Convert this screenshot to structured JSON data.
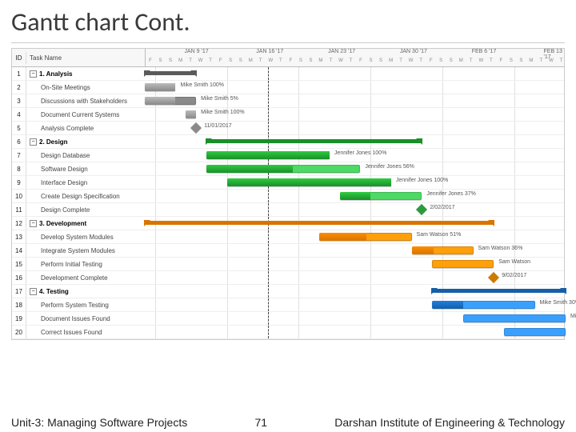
{
  "title": "Gantt chart Cont.",
  "hdr": {
    "id": "ID",
    "task": "Task Name"
  },
  "weeks": [
    "JAN 9 '17",
    "JAN 16 '17",
    "JAN 23 '17",
    "JAN 30 '17",
    "FEB 6 '17",
    "FEB 13 '17"
  ],
  "days": [
    "F",
    "S",
    "S",
    "M",
    "T",
    "W",
    "T",
    "F",
    "S",
    "S",
    "M",
    "T",
    "W",
    "T",
    "F",
    "S",
    "S",
    "M",
    "T",
    "W",
    "T",
    "F",
    "S",
    "S",
    "M",
    "T",
    "W",
    "T",
    "F",
    "S",
    "S",
    "M",
    "T",
    "W",
    "T",
    "F",
    "S",
    "S",
    "M",
    "T",
    "W",
    "T"
  ],
  "chart_data": {
    "type": "gantt",
    "time_axis": {
      "start": "2017-01-06",
      "end": "2017-02-16",
      "today": "2017-01-18"
    },
    "rows": [
      {
        "id": 1,
        "name": "1. Analysis",
        "type": "summary",
        "phase": 1,
        "start": "2017-01-06",
        "end": "2017-01-11"
      },
      {
        "id": 2,
        "name": "On-Site Meetings",
        "type": "task",
        "phase": 1,
        "start": "2017-01-06",
        "end": "2017-01-09",
        "progress": 1.0,
        "assignee": "Mike Smith",
        "pct_label": "100%"
      },
      {
        "id": 3,
        "name": "Discussions with Stakeholders",
        "type": "task",
        "phase": 1,
        "start": "2017-01-06",
        "end": "2017-01-11",
        "progress": 0.59,
        "assignee": "Mike Smith",
        "pct_label": "5%"
      },
      {
        "id": 4,
        "name": "Document Current Systems",
        "type": "task",
        "phase": 1,
        "start": "2017-01-10",
        "end": "2017-01-11",
        "progress": 1.0,
        "assignee": "Mike Smith",
        "pct_label": "100%"
      },
      {
        "id": 5,
        "name": "Analysis Complete",
        "type": "milestone",
        "phase": 1,
        "date": "2017-01-11",
        "label": "11/01/2017"
      },
      {
        "id": 6,
        "name": "2. Design",
        "type": "summary",
        "phase": 2,
        "start": "2017-01-12",
        "end": "2017-02-02"
      },
      {
        "id": 7,
        "name": "Design Database",
        "type": "task",
        "phase": 2,
        "start": "2017-01-12",
        "end": "2017-01-24",
        "progress": 1.0,
        "assignee": "Jennifer Jones",
        "pct_label": "100%"
      },
      {
        "id": 8,
        "name": "Software Design",
        "type": "task",
        "phase": 2,
        "start": "2017-01-12",
        "end": "2017-01-27",
        "progress": 0.56,
        "assignee": "Jennifer Jones",
        "pct_label": "56%"
      },
      {
        "id": 9,
        "name": "Interface Design",
        "type": "task",
        "phase": 2,
        "start": "2017-01-14",
        "end": "2017-01-30",
        "progress": 1.0,
        "assignee": "Jennifer Jones",
        "pct_label": "100%"
      },
      {
        "id": 10,
        "name": "Create Design Specification",
        "type": "task",
        "phase": 2,
        "start": "2017-01-25",
        "end": "2017-02-02",
        "progress": 0.37,
        "assignee": "Jennifer Jones",
        "pct_label": "37%"
      },
      {
        "id": 11,
        "name": "Design Complete",
        "type": "milestone",
        "phase": 2,
        "date": "2017-02-02",
        "label": "2/02/2017"
      },
      {
        "id": 12,
        "name": "3. Development",
        "type": "summary",
        "phase": 3,
        "start": "2017-01-06",
        "end": "2017-02-09"
      },
      {
        "id": 13,
        "name": "Develop System Modules",
        "type": "task",
        "phase": 3,
        "start": "2017-01-23",
        "end": "2017-02-01",
        "progress": 0.51,
        "assignee": "Sam Watson",
        "pct_label": "51%"
      },
      {
        "id": 14,
        "name": "Integrate System Modules",
        "type": "task",
        "phase": 3,
        "start": "2017-02-01",
        "end": "2017-02-07",
        "progress": 0.36,
        "assignee": "Sam Watson",
        "pct_label": "36%"
      },
      {
        "id": 15,
        "name": "Perform Initial Testing",
        "type": "task",
        "phase": 3,
        "start": "2017-02-03",
        "end": "2017-02-09",
        "progress": 0.0,
        "assignee": "Sam Watson",
        "pct_label": ""
      },
      {
        "id": 16,
        "name": "Development Complete",
        "type": "milestone",
        "phase": 3,
        "date": "2017-02-09",
        "label": "9/02/2017"
      },
      {
        "id": 17,
        "name": "4. Testing",
        "type": "summary",
        "phase": 4,
        "start": "2017-02-03",
        "end": "2017-02-16"
      },
      {
        "id": 18,
        "name": "Perform System Testing",
        "type": "task",
        "phase": 4,
        "start": "2017-02-03",
        "end": "2017-02-13",
        "progress": 0.3,
        "assignee": "Mike Smith",
        "pct_label": "30%"
      },
      {
        "id": 19,
        "name": "Document Issues Found",
        "type": "task",
        "phase": 4,
        "start": "2017-02-06",
        "end": "2017-02-16",
        "progress": 0.0,
        "assignee": "",
        "pct_label": "Mi"
      },
      {
        "id": 20,
        "name": "Correct Issues Found",
        "type": "task",
        "phase": 4,
        "start": "2017-02-10",
        "end": "2017-02-16",
        "progress": 0.0,
        "assignee": "",
        "pct_label": ""
      }
    ]
  },
  "footer": {
    "left": "Unit-3: Managing Software Projects",
    "mid": "71",
    "right": "Darshan Institute of Engineering & Technology"
  }
}
